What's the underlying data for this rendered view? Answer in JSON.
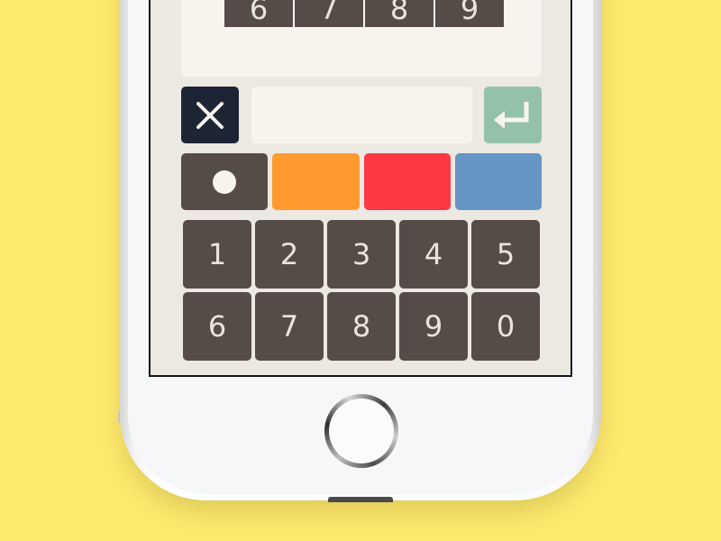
{
  "top_keys": [
    "6",
    "7",
    "8",
    "9"
  ],
  "input": {
    "value": "",
    "placeholder": ""
  },
  "buttons": {
    "clear_icon": "close-icon",
    "enter_icon": "return-arrow-icon"
  },
  "colors": {
    "background": "#FDE96E",
    "clear": "#1D2433",
    "enter": "#93C2A8",
    "white": "#554C48",
    "orange": "#FF9A2E",
    "red": "#FC3844",
    "blue": "#6595C2",
    "key": "#554C48"
  },
  "color_options": [
    {
      "name": "white",
      "icon": "dot-icon"
    },
    {
      "name": "orange"
    },
    {
      "name": "red"
    },
    {
      "name": "blue"
    }
  ],
  "keypad": {
    "row1": [
      "1",
      "2",
      "3",
      "4",
      "5"
    ],
    "row2": [
      "6",
      "7",
      "8",
      "9",
      "0"
    ]
  }
}
